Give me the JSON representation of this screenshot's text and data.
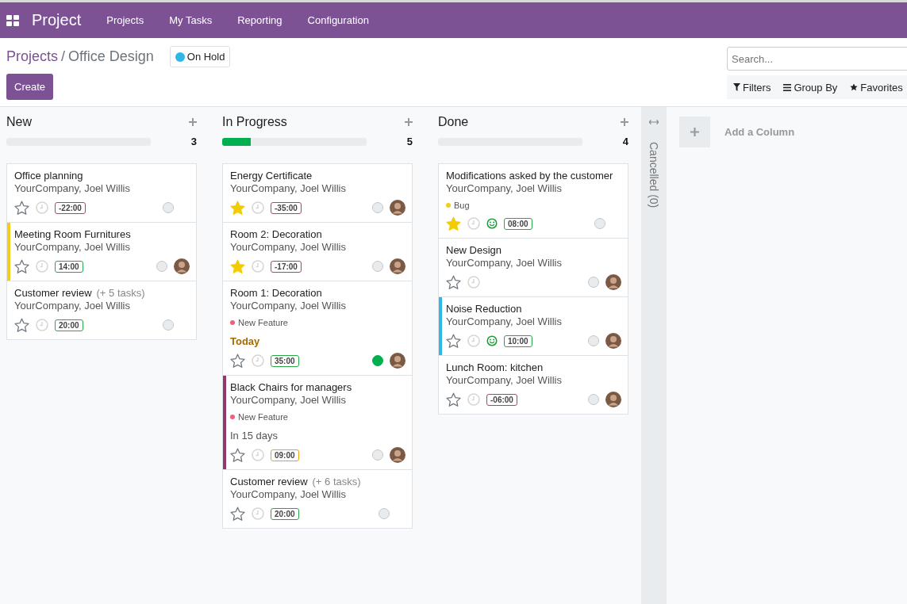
{
  "navbar": {
    "app_title": "Project",
    "menu": [
      "Projects",
      "My Tasks",
      "Reporting",
      "Configuration"
    ]
  },
  "breadcrumb": {
    "parent": "Projects",
    "separator": "/",
    "current": "Office Design"
  },
  "project_status": {
    "label": "On Hold",
    "color": "#2fb8e6"
  },
  "create_button": "Create",
  "search": {
    "placeholder": "Search..."
  },
  "search_options": [
    {
      "kind": "filter",
      "label": "Filters"
    },
    {
      "kind": "group",
      "label": "Group By"
    },
    {
      "kind": "favorite",
      "label": "Favorites"
    }
  ],
  "columns": [
    {
      "title": "New",
      "count": "3",
      "level": 0,
      "cards": [
        {
          "title": "Office planning",
          "subtitle": "YourCompany, Joel Willis",
          "starred": false,
          "hours": {
            "text": "-22:00",
            "color": "#dc3545"
          },
          "done": false,
          "avatar": false
        },
        {
          "title": "Meeting Room Furnitures",
          "subtitle": "YourCompany, Joel Willis",
          "starred": false,
          "color": "#f4cc1d",
          "hours": {
            "text": "14:00",
            "color": "#28a745"
          },
          "done": false,
          "avatar": true
        },
        {
          "title": "Customer review",
          "extra": "(+ 5 tasks)",
          "subtitle": "YourCompany, Joel Willis",
          "starred": false,
          "hours": {
            "text": "20:00",
            "color": "#28a745"
          },
          "done": false,
          "avatar": false
        }
      ]
    },
    {
      "title": "In Progress",
      "count": "5",
      "level": 0.2,
      "cards": [
        {
          "title": "Energy Certificate",
          "subtitle": "YourCompany, Joel Willis",
          "starred": true,
          "hours": {
            "text": "-35:00",
            "color": "#dc3545"
          },
          "done": false,
          "avatar": true
        },
        {
          "title": "Room 2: Decoration",
          "subtitle": "YourCompany, Joel Willis",
          "starred": true,
          "hours": {
            "text": "-17:00",
            "color": "#dc3545"
          },
          "done": false,
          "avatar": true
        },
        {
          "title": "Room 1: Decoration",
          "subtitle": "YourCompany, Joel Willis",
          "tags": [
            {
              "label": "New Feature",
              "color": "#f0607a"
            }
          ],
          "deadline": {
            "text": "Today",
            "kind": "today"
          },
          "starred": false,
          "hours": {
            "text": "35:00",
            "color": "#28a745"
          },
          "done": true,
          "avatar": true
        },
        {
          "title": "Black Chairs for managers",
          "subtitle": "YourCompany, Joel Willis",
          "color": "#8e3a6e",
          "tags": [
            {
              "label": "New Feature",
              "color": "#f0607a"
            }
          ],
          "deadline": {
            "text": "In 15 days",
            "kind": "future"
          },
          "starred": false,
          "hours": {
            "text": "09:00",
            "color": "#f0a30a"
          },
          "done": false,
          "avatar": true
        },
        {
          "title": "Customer review",
          "extra": "(+ 6 tasks)",
          "subtitle": "YourCompany, Joel Willis",
          "starred": false,
          "hours": {
            "text": "20:00",
            "color": "#28a745"
          },
          "done": false,
          "avatar": false
        }
      ]
    },
    {
      "title": "Done",
      "count": "4",
      "level": 0,
      "cards": [
        {
          "title": "Modifications asked by the customer",
          "subtitle": "YourCompany, Joel Willis",
          "tags": [
            {
              "label": "Bug",
              "color": "#f4cc1d"
            }
          ],
          "starred": true,
          "satisfied": true,
          "hours": {
            "text": "08:00",
            "color": "#28a745"
          },
          "done": false,
          "avatar": false
        },
        {
          "title": "New Design",
          "subtitle": "YourCompany, Joel Willis",
          "starred": false,
          "done": false,
          "avatar": true
        },
        {
          "title": "Noise Reduction",
          "subtitle": "YourCompany, Joel Willis",
          "color": "#2fb8e6",
          "starred": false,
          "satisfied": true,
          "hours": {
            "text": "10:00",
            "color": "#28a745"
          },
          "done": false,
          "avatar": true
        },
        {
          "title": "Lunch Room: kitchen",
          "subtitle": "YourCompany, Joel Willis",
          "starred": false,
          "hours": {
            "text": "-06:00",
            "color": "#dc3545"
          },
          "done": false,
          "avatar": true
        }
      ]
    }
  ],
  "folded_column": {
    "title": "Cancelled (0)"
  },
  "add_column": {
    "label": "Add a Column"
  }
}
